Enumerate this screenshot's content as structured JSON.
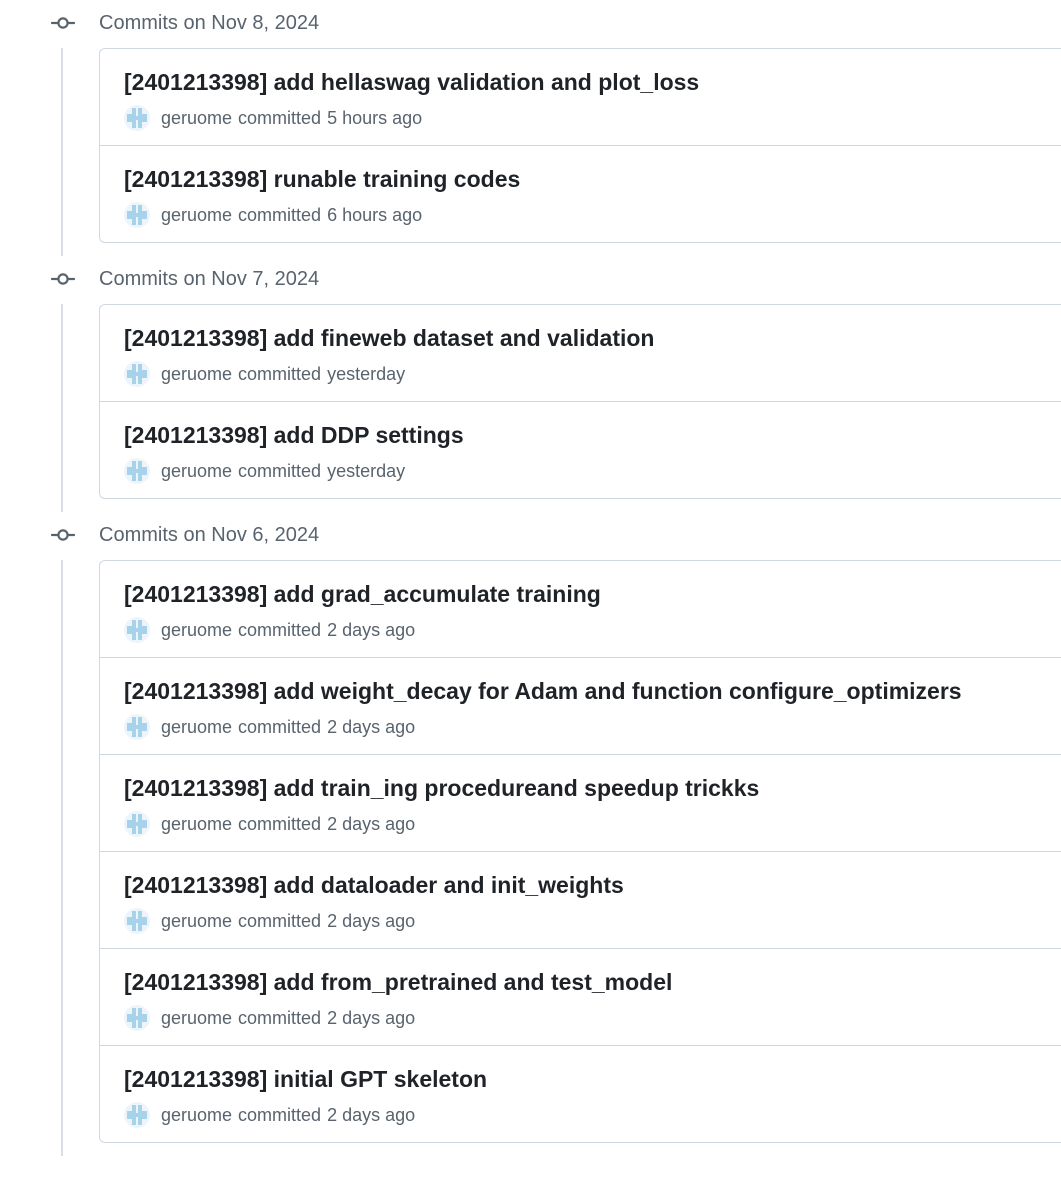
{
  "groups": [
    {
      "title": "Commits on Nov 8, 2024",
      "commits": [
        {
          "message": "[2401213398] add hellaswag validation and plot_loss",
          "author": "geruome",
          "verb": "committed",
          "time": "5 hours ago"
        },
        {
          "message": "[2401213398] runable training codes",
          "author": "geruome",
          "verb": "committed",
          "time": "6 hours ago"
        }
      ]
    },
    {
      "title": "Commits on Nov 7, 2024",
      "commits": [
        {
          "message": "[2401213398] add fineweb dataset and validation",
          "author": "geruome",
          "verb": "committed",
          "time": "yesterday"
        },
        {
          "message": "[2401213398] add DDP settings",
          "author": "geruome",
          "verb": "committed",
          "time": "yesterday"
        }
      ]
    },
    {
      "title": "Commits on Nov 6, 2024",
      "commits": [
        {
          "message": "[2401213398] add grad_accumulate training",
          "author": "geruome",
          "verb": "committed",
          "time": "2 days ago"
        },
        {
          "message": "[2401213398] add weight_decay for Adam and function configure_optimizers",
          "author": "geruome",
          "verb": "committed",
          "time": "2 days ago"
        },
        {
          "message": "[2401213398] add train_ing procedureand speedup trickks",
          "author": "geruome",
          "verb": "committed",
          "time": "2 days ago"
        },
        {
          "message": "[2401213398] add dataloader and init_weights",
          "author": "geruome",
          "verb": "committed",
          "time": "2 days ago"
        },
        {
          "message": "[2401213398] add from_pretrained and test_model",
          "author": "geruome",
          "verb": "committed",
          "time": "2 days ago"
        },
        {
          "message": "[2401213398] initial GPT skeleton",
          "author": "geruome",
          "verb": "committed",
          "time": "2 days ago"
        }
      ]
    }
  ],
  "icons": {
    "group_marker": "git-commit-icon",
    "author_avatar": "identicon-avatar"
  },
  "colors": {
    "text_primary": "#1f2328",
    "text_muted": "#59636e",
    "border": "#d1d9e0",
    "timeline_line": "#d8dee4",
    "avatar_identicon": "#a7d3ea"
  }
}
